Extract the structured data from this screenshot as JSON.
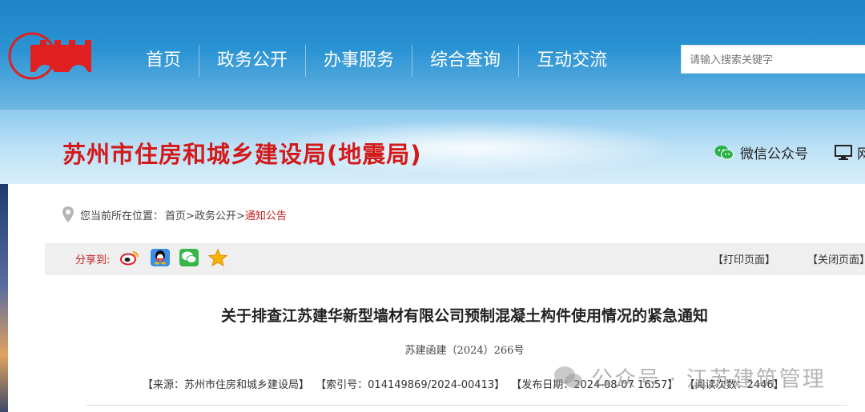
{
  "nav": {
    "items": [
      "首页",
      "政务公开",
      "办事服务",
      "综合查询",
      "互动交流"
    ]
  },
  "search": {
    "placeholder": "请输入搜索关键字"
  },
  "header": {
    "site_name": "苏州市住房和城乡建设局(地震局)",
    "wechat_label": "微信公众号",
    "pc_label": "网"
  },
  "breadcrumb": {
    "prefix": "您当前所在位置：",
    "home": "首页",
    "sep1": ">",
    "section": "政务公开",
    "sep2": ">",
    "current": "通知公告"
  },
  "share": {
    "label": "分享到:",
    "icons": [
      "weibo-icon",
      "qq-icon",
      "wechat-icon",
      "favorite-star-icon"
    ],
    "print_label": "【打印页面】",
    "close_label": "【关闭页面】"
  },
  "article": {
    "title": "关于排查江苏建华新型墙材有限公司预制混凝土构件使用情况的紧急通知",
    "doc_number": "苏建函建（2024）266号",
    "source": "【来源：苏州市住房和城乡建设局】",
    "index_no": "【索引号：014149869/2024-00413】",
    "publish_date": "【发布日期：2024-08-07 16:57】",
    "views": "【阅读次数：2446】"
  },
  "watermark": {
    "text": "公众号 · 江苏建筑管理"
  },
  "colors": {
    "brand_red": "#d31919",
    "nav_blue": "#1f84c8",
    "link_red": "#c81e1e"
  }
}
